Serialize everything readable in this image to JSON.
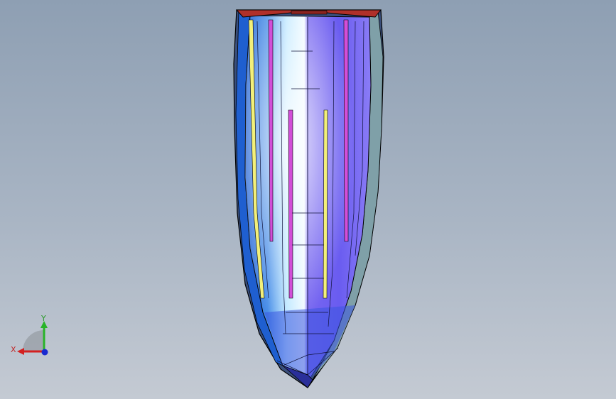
{
  "viewport": {
    "background_top": "#8e9fb3",
    "background_bottom": "#c4cad3"
  },
  "model": {
    "icon": "boat-hull-model",
    "colors": {
      "outline": "#000000",
      "transom": "#b0302a",
      "hull_left": "#3f7fe0",
      "hull_light": "#e6f4ff",
      "hull_center": "#6f5cf0",
      "hull_right": "#8a78f5",
      "gunwale_right": "#7fa0a8",
      "chine_yellow": "#f3f07a",
      "chine_magenta": "#d24ed8"
    }
  },
  "triad": {
    "x_label": "X",
    "y_label": "Y",
    "x_color": "#d42020",
    "y_color": "#28b428",
    "z_color": "#1a2ad0"
  }
}
